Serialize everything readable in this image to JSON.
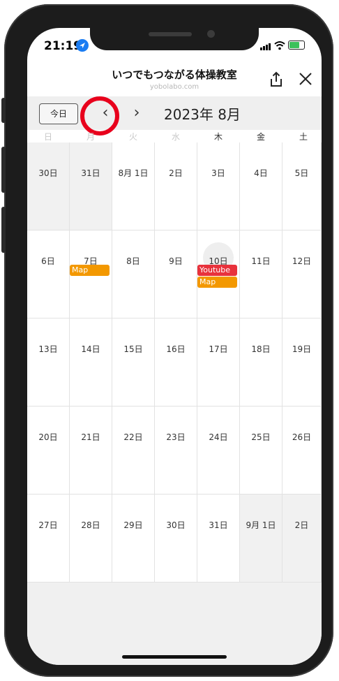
{
  "status_bar": {
    "time": "21:19"
  },
  "header": {
    "title": "いつでもつながる体操教室",
    "subtitle": "yobolabo.com"
  },
  "toolbar": {
    "today_label": "今日",
    "prev_label": "‹",
    "next_label": "›",
    "month_title": "2023年 8月"
  },
  "weekdays": [
    "日",
    "月",
    "火",
    "水",
    "木",
    "金",
    "土"
  ],
  "weeks": [
    [
      "30日",
      "31日",
      "8月 1日",
      "2日",
      "3日",
      "4日",
      "5日"
    ],
    [
      "6日",
      "7日",
      "8日",
      "9日",
      "10日",
      "11日",
      "12日"
    ],
    [
      "13日",
      "14日",
      "15日",
      "16日",
      "17日",
      "18日",
      "19日"
    ],
    [
      "20日",
      "21日",
      "22日",
      "23日",
      "24日",
      "25日",
      "26日"
    ],
    [
      "27日",
      "28日",
      "29日",
      "30日",
      "31日",
      "9月 1日",
      "2日"
    ]
  ],
  "events": {
    "aug7": [
      {
        "label": "Map",
        "color": "#f39800"
      }
    ],
    "aug10": [
      {
        "label": "Youtube",
        "color": "#e8323c"
      },
      {
        "label": "Map",
        "color": "#f39800"
      }
    ]
  },
  "colors": {
    "accent_ring": "#e8001c",
    "event_orange": "#f39800",
    "event_red": "#e8323c"
  }
}
